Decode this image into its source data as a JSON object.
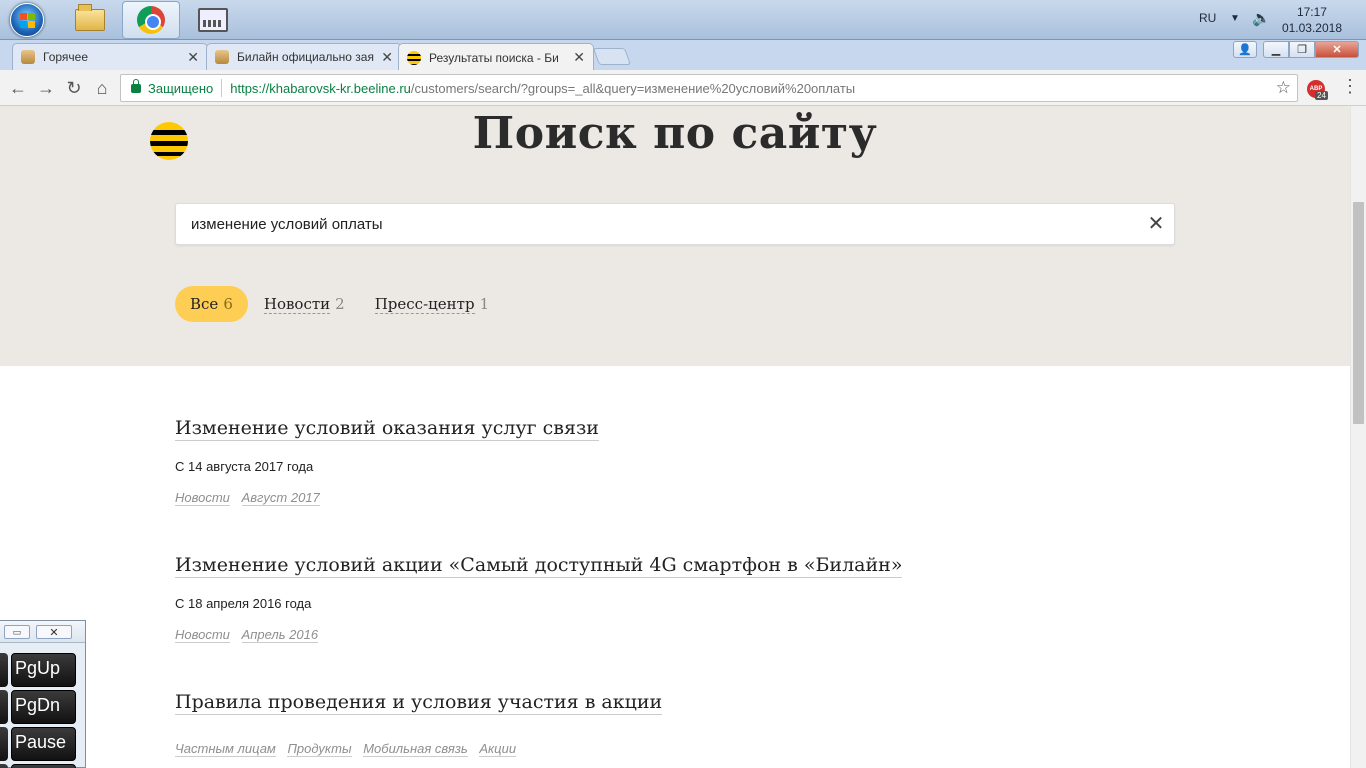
{
  "taskbar": {
    "language": "RU",
    "time": "17:17",
    "date": "01.03.2018"
  },
  "tabs": [
    {
      "label": "Горячее"
    },
    {
      "label": "Билайн официально зая"
    },
    {
      "label": "Результаты поиска - Би"
    }
  ],
  "toolbar": {
    "secure_label": "Защищено",
    "url_host": "https://khabarovsk-kr.beeline.ru",
    "url_path": "/customers/search/?groups=_all&query=изменение%20условий%20оплаты",
    "ext_badge": "ABP",
    "ext_count": "24"
  },
  "page": {
    "title": "Поиск по сайту",
    "search_value": "изменение условий оплаты",
    "filters": [
      {
        "label": "Все",
        "count": "6"
      },
      {
        "label": "Новости",
        "count": "2"
      },
      {
        "label": "Пресс-центр",
        "count": "1"
      }
    ],
    "results": [
      {
        "title": "Изменение условий оказания услуг связи",
        "snippet": "С 14 августа 2017 года",
        "tags": [
          "Новости",
          "Август 2017"
        ]
      },
      {
        "title": "Изменение условий акции «Самый доступный 4G смартфон в «Билайн»",
        "snippet": "С 18 апреля 2016 года",
        "tags": [
          "Новости",
          "Апрель 2016"
        ]
      },
      {
        "title": "Правила проведения и условия участия в акции",
        "snippet": "",
        "tags": [
          "Частным лицам",
          "Продукты",
          "Мобильная связь",
          "Акции"
        ]
      }
    ]
  },
  "osk": {
    "keys": [
      "PgUp",
      "PgDn",
      "Pause"
    ]
  },
  "colors": {
    "hero_bg": "#ece9e4",
    "active_filter": "#fecd54",
    "secure_green": "#0b8043",
    "beeline_yellow": "#ffc800"
  }
}
